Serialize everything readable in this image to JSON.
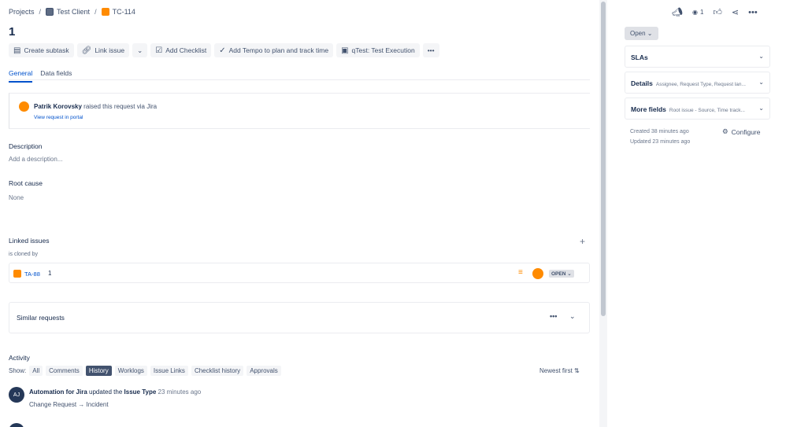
{
  "breadcrumbs": {
    "projects": "Projects",
    "project": "Test Client",
    "issue_key": "TC-114"
  },
  "issue": {
    "title": "1"
  },
  "toolbar": {
    "create_subtask": "Create subtask",
    "link_issue": "Link issue",
    "add_checklist": "Add Checklist",
    "add_tempo": "Add Tempo to plan and track time",
    "qtest": "qTest: Test Execution"
  },
  "tabs": {
    "general": "General",
    "data_fields": "Data fields"
  },
  "request": {
    "reporter": "Patrik Korovsky",
    "raised_text": "raised this request via",
    "channel": "Jira",
    "view_link": "View request in portal"
  },
  "fields": {
    "description_label": "Description",
    "description_placeholder": "Add a description...",
    "root_cause_label": "Root cause",
    "root_cause_value": "None"
  },
  "linked": {
    "label": "Linked issues",
    "relation": "is cloned by",
    "item": {
      "key": "TA-88",
      "summary": "1",
      "status": "OPEN"
    }
  },
  "similar": {
    "label": "Similar requests"
  },
  "activity": {
    "label": "Activity",
    "show_label": "Show:",
    "filters": [
      "All",
      "Comments",
      "History",
      "Worklogs",
      "Issue Links",
      "Checklist history",
      "Approvals"
    ],
    "active_filter": "History",
    "sort": "Newest first",
    "entries": [
      {
        "avatar": "AJ",
        "actor": "Automation for Jira",
        "action": "updated the",
        "field": "Issue Type",
        "time": "23 minutes ago",
        "from": "Change Request",
        "to": "Incident"
      }
    ]
  },
  "sidebar": {
    "watch_count": "1",
    "status_button": "Open",
    "panels": [
      {
        "title": "SLAs",
        "summary": ""
      },
      {
        "title": "Details",
        "summary": "Assignee, Request Type, Request lan..."
      },
      {
        "title": "More fields",
        "summary": "Root issue - Source, Time track..."
      }
    ],
    "created": "Created 38 minutes ago",
    "updated": "Updated 23 minutes ago",
    "configure": "Configure"
  },
  "colors": {
    "link": "#0052cc",
    "accent": "#ff8b00",
    "text": "#172b4d"
  }
}
